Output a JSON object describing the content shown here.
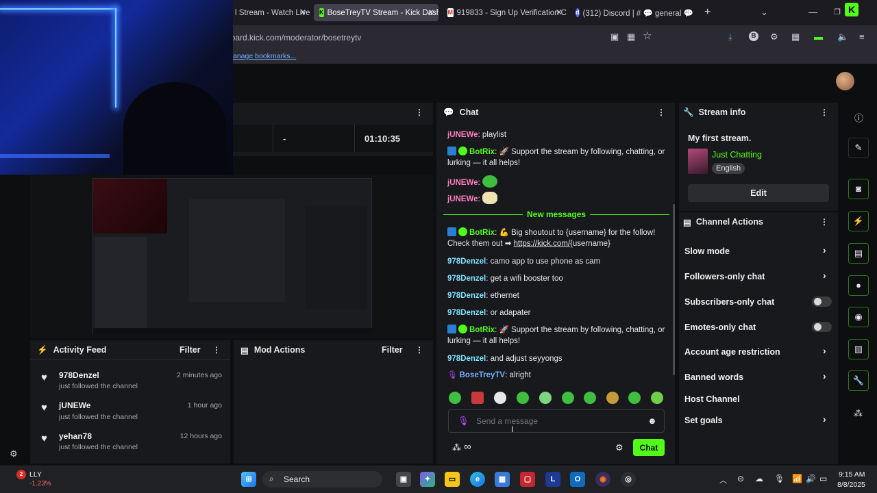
{
  "browser": {
    "tabs": [
      {
        "label": "l Stream - Watch Live"
      },
      {
        "label": "BoseTreyTV Stream - Kick Dashl"
      },
      {
        "label": "919833 - Sign Up Verification C"
      },
      {
        "label": "(312) Discord | # 💬 general 💬 |"
      }
    ],
    "url": "board.kick.com/moderator/bosetreytv",
    "bookmark_link": "anage bookmarks..."
  },
  "stats": {
    "viewers": "-",
    "uptime": "01:10:35"
  },
  "activity_feed": {
    "title": "Activity Feed",
    "filter_label": "Filter",
    "items": [
      {
        "user": "978Denzel",
        "time": "2 minutes ago",
        "text": "just followed the channel"
      },
      {
        "user": "jUNEWe",
        "time": "1 hour ago",
        "text": "just followed the channel"
      },
      {
        "user": "yehan78",
        "time": "12 hours ago",
        "text": "just followed the channel"
      }
    ]
  },
  "mod_actions": {
    "title": "Mod Actions",
    "filter_label": "Filter"
  },
  "chat": {
    "title": "Chat",
    "new_messages_label": "New messages",
    "input_placeholder": "Send a message",
    "send_label": "Chat",
    "messages": [
      {
        "user": "jUNEWe",
        "text": "playlist"
      },
      {
        "user": "BotRix",
        "text": "🚀 Support the stream by following, chatting, or lurking — it all helps!"
      },
      {
        "user": "jUNEWe",
        "text": ""
      },
      {
        "user": "jUNEWe",
        "text": ""
      },
      {
        "user": "BotRix",
        "text": "💪 Big shoutout to {username} for the follow! Check them out ➡",
        "link": "https://kick.com/",
        "after_link": "{username}"
      },
      {
        "user": "978Denzel",
        "text": "camo app to use phone as cam"
      },
      {
        "user": "978Denzel",
        "text": "get a wifi booster too"
      },
      {
        "user": "978Denzel",
        "text": "ethernet"
      },
      {
        "user": "978Denzel",
        "text": "or adapater"
      },
      {
        "user": "BotRix",
        "text": "🚀 Support the stream by following, chatting, or lurking — it all helps!"
      },
      {
        "user": "978Denzel",
        "text": "and adjust seyyongs"
      },
      {
        "user": "BoseTreyTV",
        "text": "alright"
      }
    ]
  },
  "stream_info": {
    "title": "Stream info",
    "stream_title": "My first stream.",
    "category": "Just Chatting",
    "language": "English",
    "edit_label": "Edit"
  },
  "channel_actions": {
    "title": "Channel Actions",
    "items": [
      {
        "label": "Slow mode",
        "control": "chevron"
      },
      {
        "label": "Followers-only chat",
        "control": "chevron"
      },
      {
        "label": "Subscribers-only chat",
        "control": "toggle"
      },
      {
        "label": "Emotes-only chat",
        "control": "toggle"
      },
      {
        "label": "Account age restriction",
        "control": "chevron"
      },
      {
        "label": "Banned words",
        "control": "chevron"
      },
      {
        "label": "Host Channel",
        "control": "none"
      },
      {
        "label": "Set goals",
        "control": "chevron"
      }
    ]
  },
  "taskbar": {
    "stock_ticker": "LLY",
    "stock_change": "-1.23%",
    "search_label": "Search",
    "time": "9:15 AM",
    "date": "8/8/2025"
  },
  "colors": {
    "accent": "#53fc18",
    "panel": "#18191c",
    "background": "#0d0e10"
  }
}
